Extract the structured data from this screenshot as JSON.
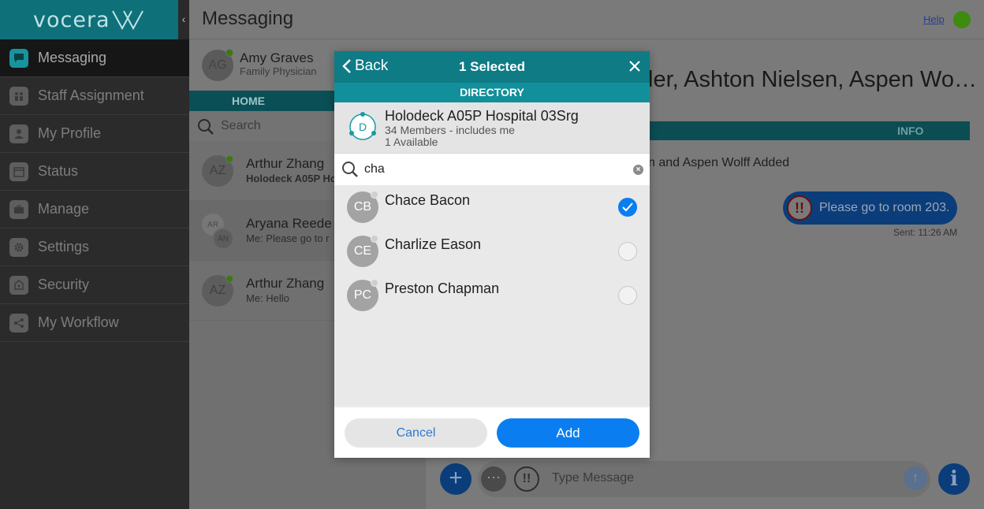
{
  "app": {
    "logo_text": "vocera",
    "page_title": "Messaging",
    "help_label": "Help",
    "status_color": "#3d8b0f"
  },
  "sidebar": {
    "items": [
      {
        "label": "Messaging",
        "icon": "chat-bubble-icon",
        "active": true
      },
      {
        "label": "Staff Assignment",
        "icon": "staff-icon"
      },
      {
        "label": "My Profile",
        "icon": "profile-icon"
      },
      {
        "label": "Status",
        "icon": "calendar-icon"
      },
      {
        "label": "Manage",
        "icon": "briefcase-icon"
      },
      {
        "label": "Settings",
        "icon": "gear-icon"
      },
      {
        "label": "Security",
        "icon": "lock-icon"
      },
      {
        "label": "My Workflow",
        "icon": "workflow-icon"
      }
    ]
  },
  "me": {
    "initials": "AG",
    "name": "Amy Graves",
    "role": "Family Physician"
  },
  "convlist": {
    "home_tab": "HOME",
    "search_placeholder": "Search",
    "items": [
      {
        "initials": "AZ",
        "name": "Arthur Zhang",
        "sub": "Holodeck A05P Ho"
      },
      {
        "initials_a": "AR",
        "initials_b": "AN",
        "name": "Aryana Reede",
        "sub": "Me: Please go to r"
      },
      {
        "initials": "AZ",
        "name": "Arthur Zhang",
        "sub": "Me: Hello"
      }
    ]
  },
  "chat": {
    "title": "ler, Ashton Nielsen, Aspen Wo…",
    "tab_left": "",
    "tab_info": "INFO",
    "system_message": "n and Aspen Wolff Added",
    "message_text": "Please go to room 203.",
    "urgent_mark": "!!",
    "sent_time": "Sent: 11:26 AM",
    "composer_placeholder": "Type Message",
    "info_glyph": "i"
  },
  "modal": {
    "back_label": "Back",
    "selected_label": "1 Selected",
    "section_label": "DIRECTORY",
    "group": {
      "badge": "D",
      "name": "Holodeck A05P Hospital 03Srg",
      "members": "34 Members - includes me",
      "available": "1 Available"
    },
    "search_value": "cha",
    "people": [
      {
        "initials": "CB",
        "name": "Chace Bacon",
        "selected": true
      },
      {
        "initials": "CE",
        "name": "Charlize Eason",
        "selected": false
      },
      {
        "initials": "PC",
        "name": "Preston Chapman",
        "selected": false
      }
    ],
    "cancel_label": "Cancel",
    "add_label": "Add"
  },
  "colors": {
    "teal": "#0e7b85",
    "accent_blue": "#0a7ef0",
    "sidebar_bg": "#2b2b2b"
  }
}
